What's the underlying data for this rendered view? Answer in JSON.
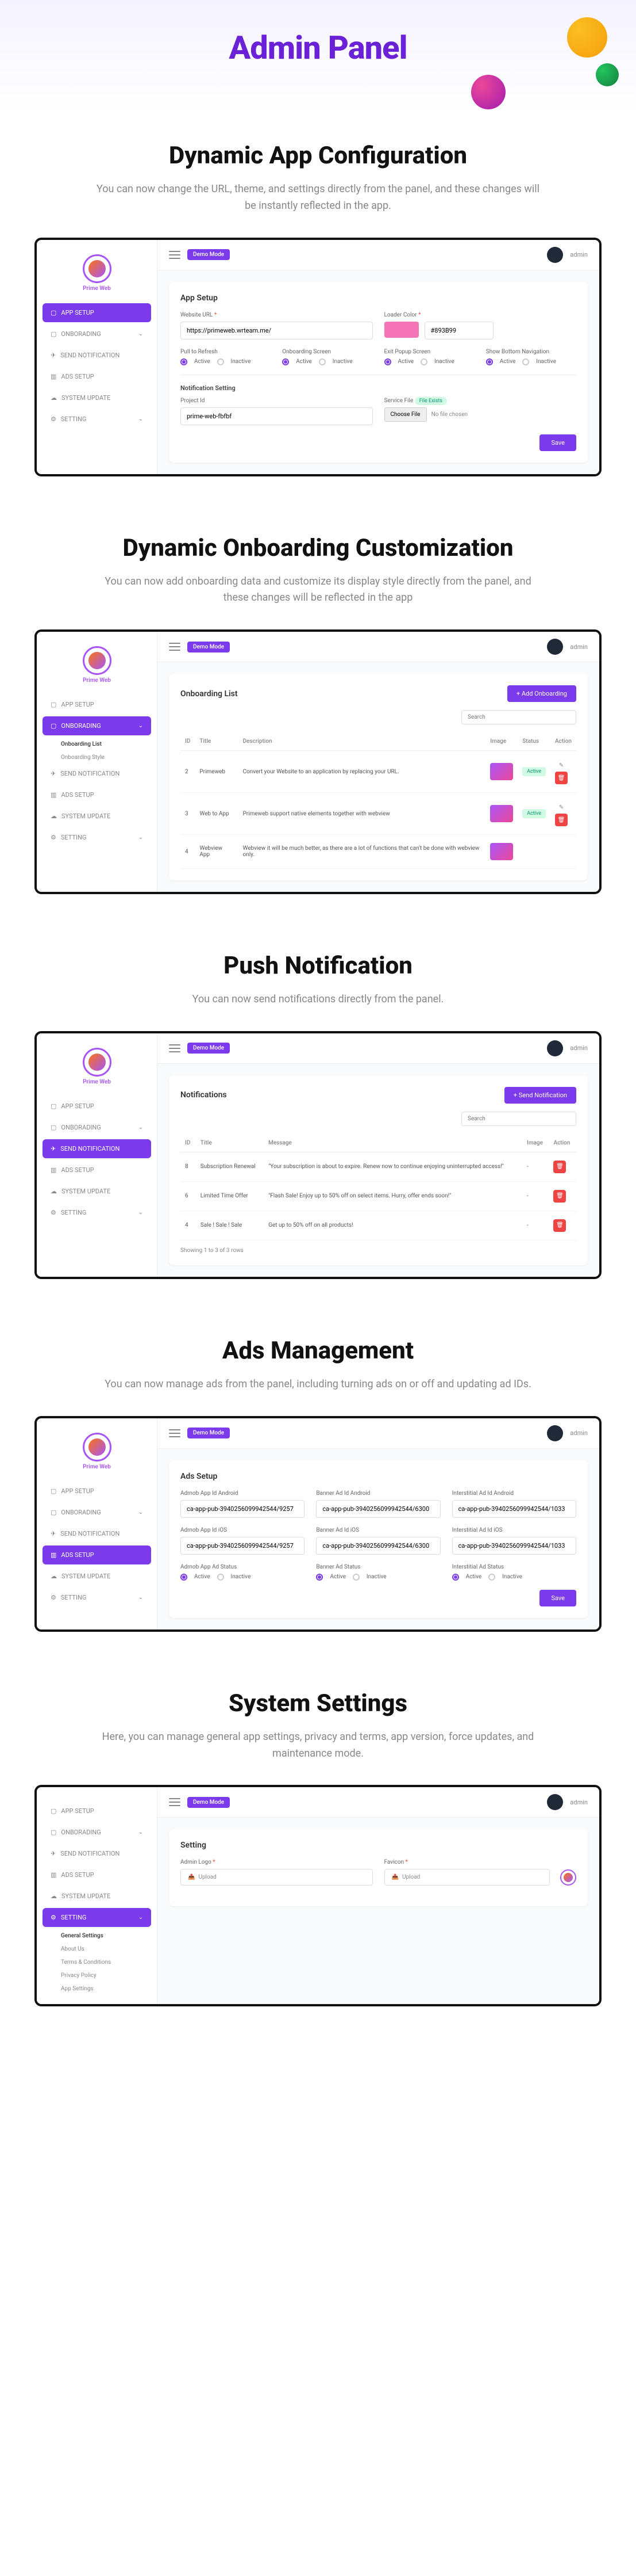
{
  "hero": {
    "title": "Admin Panel"
  },
  "common": {
    "brand": "Prime Web",
    "demo_mode": "Demo Mode",
    "admin": "admin",
    "save": "Save",
    "search": "Search",
    "active": "Active",
    "inactive": "Inactive"
  },
  "nav": {
    "app_setup": "APP SETUP",
    "onboarding": "ONBORADING",
    "onboarding_list": "Onboarding List",
    "onboarding_style": "Onboarding Style",
    "send_notification": "SEND NOTIFICATION",
    "ads_setup": "ADS SETUP",
    "system_update": "SYSTEM UPDATE",
    "setting": "SETTING",
    "general": "General Settings",
    "about": "About Us",
    "terms": "Terms & Conditions",
    "privacy": "Privacy Policy",
    "app_settings": "App Settings"
  },
  "s1": {
    "heading": "Dynamic App Configuration",
    "desc": "You can now change the URL, theme, and settings directly from the panel, and these changes will be instantly reflected in the app.",
    "card_title": "App Setup",
    "website_url_label": "Website URL",
    "website_url_value": "https://primeweb.wrteam.me/",
    "loader_color_label": "Loader Color",
    "loader_color_value": "#893B99",
    "pull_refresh": "Pull to Refresh",
    "onboarding_screen": "Onboarding Screen",
    "exit_popup": "Exit Popup Screen",
    "bottom_nav": "Show Bottom Navigation",
    "notif_title": "Notification Setting",
    "project_id": "Project Id",
    "project_id_value": "prime-web-fbfbf",
    "service_file": "Service File",
    "file_exists": "File Exists",
    "choose_file": "Choose File",
    "no_file": "No file chosen"
  },
  "s2": {
    "heading": "Dynamic Onboarding Customization",
    "desc": "You can now add onboarding data and customize its display style directly from the panel, and these changes will be reflected in the app",
    "card_title": "Onboarding List",
    "add_btn": "+ Add Onboarding",
    "cols": {
      "id": "ID",
      "title": "Title",
      "description": "Description",
      "image": "Image",
      "status": "Status",
      "action": "Action"
    },
    "rows": [
      {
        "id": "2",
        "title": "Primeweb",
        "desc": "Convert your Website to an application by replacing your URL.",
        "status": "Active"
      },
      {
        "id": "3",
        "title": "Web to App",
        "desc": "Primeweb support native elements together with webview",
        "status": "Active"
      },
      {
        "id": "4",
        "title": "Webview App",
        "desc": "Webview it will be much better, as there are a lot of functions that can't be done with webview only.",
        "status": ""
      }
    ]
  },
  "s3": {
    "heading": "Push Notification",
    "desc": "You can now send notifications directly from the panel.",
    "card_title": "Notifications",
    "send_btn": "+ Send Notification",
    "cols": {
      "id": "ID",
      "title": "Title",
      "message": "Message",
      "image": "Image",
      "action": "Action"
    },
    "rows": [
      {
        "id": "8",
        "title": "Subscription Renewal",
        "msg": "\"Your subscription is about to expire. Renew now to continue enjoying uninterrupted access!\""
      },
      {
        "id": "6",
        "title": "Limited Time Offer",
        "msg": "\"Flash Sale! Enjoy up to 50% off on select items. Hurry, offer ends soon!\""
      },
      {
        "id": "4",
        "title": "Sale ! Sale ! Sale",
        "msg": "Get up to 50% off on all products!"
      }
    ],
    "footer": "Showing 1 to 3 of 3 rows"
  },
  "s4": {
    "heading": "Ads Management",
    "desc": "You can now manage ads from the panel, including turning ads on or off and updating ad IDs.",
    "card_title": "Ads Setup",
    "admob_android_label": "Admob App Id Android",
    "admob_android_value": "ca-app-pub-3940256099942544/9257",
    "banner_android_label": "Banner Ad Id Android",
    "banner_android_value": "ca-app-pub-3940256099942544/6300",
    "inter_android_label": "Interstitial Ad Id Android",
    "inter_android_value": "ca-app-pub-3940256099942544/1033",
    "admob_ios_label": "Admob App Id iOS",
    "admob_ios_value": "ca-app-pub-3940256099942544/9257",
    "banner_ios_label": "Banner Ad Id iOS",
    "banner_ios_value": "ca-app-pub-3940256099942544/6300",
    "inter_ios_label": "Interstitial Ad Id iOS",
    "inter_ios_value": "ca-app-pub-3940256099942544/1033",
    "admob_status": "Admob App Ad Status",
    "banner_status": "Banner Ad Status",
    "inter_status": "Interstitial Ad Status"
  },
  "s5": {
    "heading": "System Settings",
    "desc": "Here, you can manage general app settings, privacy and terms, app version, force updates, and maintenance mode.",
    "card_title": "Setting",
    "admin_logo": "Admin Logo",
    "favicon": "Favicon",
    "upload": "Upload"
  }
}
